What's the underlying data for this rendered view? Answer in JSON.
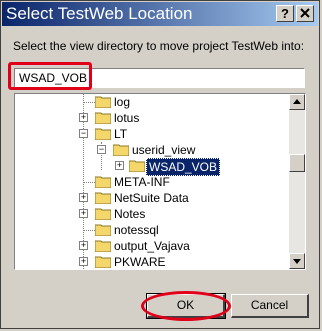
{
  "window": {
    "title": "Select TestWeb Location",
    "help_label": "?",
    "close_label": "X"
  },
  "instruction": "Select the view directory to move project TestWeb into:",
  "location_field": {
    "value": "WSAD_VOB"
  },
  "tree": {
    "items": [
      {
        "label": "log",
        "expander": ""
      },
      {
        "label": "lotus",
        "expander": "+"
      },
      {
        "label": "LT",
        "expander": "−"
      },
      {
        "label": "userid_view",
        "expander": "−"
      },
      {
        "label": "WSAD_VOB",
        "expander": "+",
        "selected": true
      },
      {
        "label": "META-INF",
        "expander": ""
      },
      {
        "label": "NetSuite Data",
        "expander": "+"
      },
      {
        "label": "Notes",
        "expander": "+"
      },
      {
        "label": "notessql",
        "expander": ""
      },
      {
        "label": "output_Vajava",
        "expander": "+"
      },
      {
        "label": "PKWARE",
        "expander": "+"
      }
    ]
  },
  "buttons": {
    "ok": "OK",
    "cancel": "Cancel"
  },
  "colors": {
    "highlight_red": "#e0001a",
    "selection": "#0a246a",
    "folder_yellow": "#f5d66b"
  }
}
